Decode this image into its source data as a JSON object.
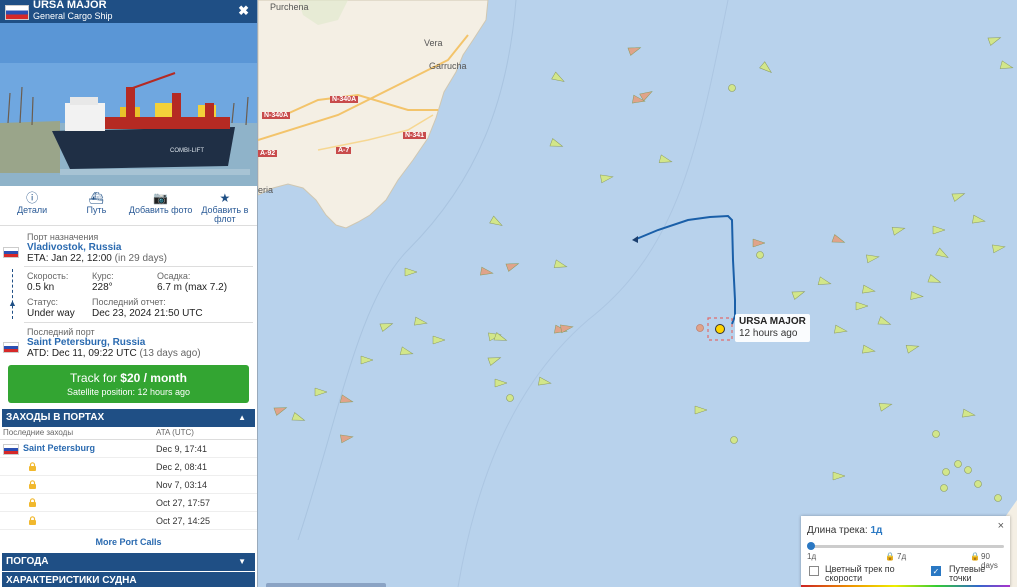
{
  "vessel": {
    "name": "URSA MAJOR",
    "type": "General Cargo Ship",
    "close_glyph": "✖"
  },
  "actions": [
    {
      "icon": "info-icon",
      "label": "Детали"
    },
    {
      "icon": "ship-icon",
      "label": "Путь"
    },
    {
      "icon": "camera-icon",
      "label": "Добавить фото"
    },
    {
      "icon": "star-icon",
      "label": "Добавить в флот"
    }
  ],
  "voyage": {
    "dest_label": "Порт назначения",
    "dest_port": "Vladivostok, Russia",
    "eta_label": "ETA:",
    "eta_value": "Jan 22, 12:00",
    "eta_note": "(in 29 days)",
    "speed_label": "Скорость:",
    "speed_value": "0.5 kn",
    "course_label": "Курс:",
    "course_value": "228°",
    "draught_label": "Осадка:",
    "draught_value": "6.7 m (max 7.2)",
    "status_label": "Статус:",
    "status_value": "Under way",
    "report_label": "Последний отчет:",
    "report_value": "Dec 23, 2024 21:50 UTC",
    "last_port_label": "Последний порт",
    "last_port": "Saint Petersburg, Russia",
    "atd_label": "ATD:",
    "atd_value": "Dec 11, 09:22 UTC",
    "atd_note": "(13 days ago)"
  },
  "track_button": {
    "prefix": "Track for ",
    "price": "$20 / month",
    "sub": "Satellite position: 12 hours ago"
  },
  "port_calls": {
    "title": "ЗАХОДЫ В ПОРТАХ",
    "col1": "Последние заходы",
    "col2": "ATA (UTC)",
    "rows": [
      {
        "port": "Saint Petersburg",
        "ata": "Dec 9, 17:41"
      },
      {
        "port": "",
        "ata": "Dec 2, 08:41"
      },
      {
        "port": "",
        "ata": "Nov 7, 03:14"
      },
      {
        "port": "",
        "ata": "Oct 27, 17:57"
      },
      {
        "port": "",
        "ata": "Oct 27, 14:25"
      }
    ],
    "more": "More Port Calls"
  },
  "sections": {
    "weather": "ПОГОДА",
    "specs": "ХАРАКТЕРИСТИКИ СУДНА"
  },
  "map": {
    "ship_label_name": "URSA MAJOR",
    "ship_label_time": "12 hours ago",
    "towns": [
      "Purchena",
      "Vera",
      "Garrucha",
      "Almería"
    ],
    "town_visible": [
      "Purchena",
      "Vera",
      "Garrucha",
      "eria"
    ],
    "roads": [
      "N-340A",
      "N-340A",
      "A-7",
      "N-341",
      "A-92"
    ]
  },
  "track_panel": {
    "title": "Длина трека:",
    "value": "1д",
    "tick_1": "1д",
    "tick_2": "7д",
    "tick_3": "90 days",
    "opt_color": "Цветный трек по скорости",
    "opt_waypoints": "Путевые точки",
    "close": "×"
  },
  "colors": {
    "header_blue": "#1f4f85",
    "link_blue": "#2a6ab0",
    "button_green": "#33a532",
    "sea": "#b8d2ec",
    "land": "#f4efe4",
    "track": "#1a5fa8",
    "cargo_marker": "#d2e68a",
    "tanker_marker": "#e0a38a"
  }
}
